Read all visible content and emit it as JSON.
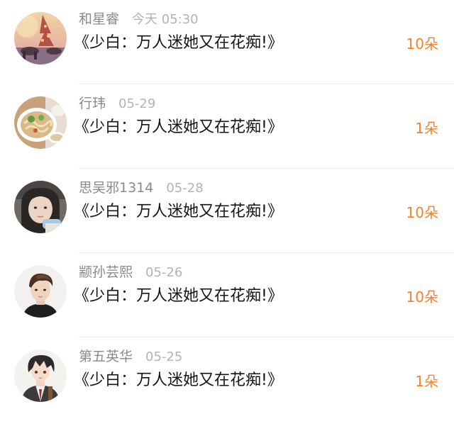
{
  "items": [
    {
      "name": "和星睿",
      "time": "今天 05:30",
      "title": "《少白：万人迷她又在花痴!》",
      "count": "10朵",
      "avatar_icon": "park-bench-sunset-avatar"
    },
    {
      "name": "行玮",
      "time": "05-29",
      "title": "《少白：万人迷她又在花痴!》",
      "count": "1朵",
      "avatar_icon": "noodle-bowl-avatar"
    },
    {
      "name": "思吴邪1314",
      "time": "05-28",
      "title": "《少白：万人迷她又在花痴!》",
      "count": "10朵",
      "avatar_icon": "girl-selfie-avatar"
    },
    {
      "name": "颛孙芸熙",
      "time": "05-26",
      "title": "《少白：万人迷她又在花痴!》",
      "count": "10朵",
      "avatar_icon": "young-man-portrait-avatar"
    },
    {
      "name": "第五英华",
      "time": "05-25",
      "title": "《少白：万人迷她又在花痴!》",
      "count": "1朵",
      "avatar_icon": "anime-boy-avatar"
    }
  ],
  "colors": {
    "accent": "#f5822b",
    "name": "#8a8a8a",
    "time": "#b3b3b3",
    "title": "#141414",
    "divider": "#f1f1f1"
  }
}
